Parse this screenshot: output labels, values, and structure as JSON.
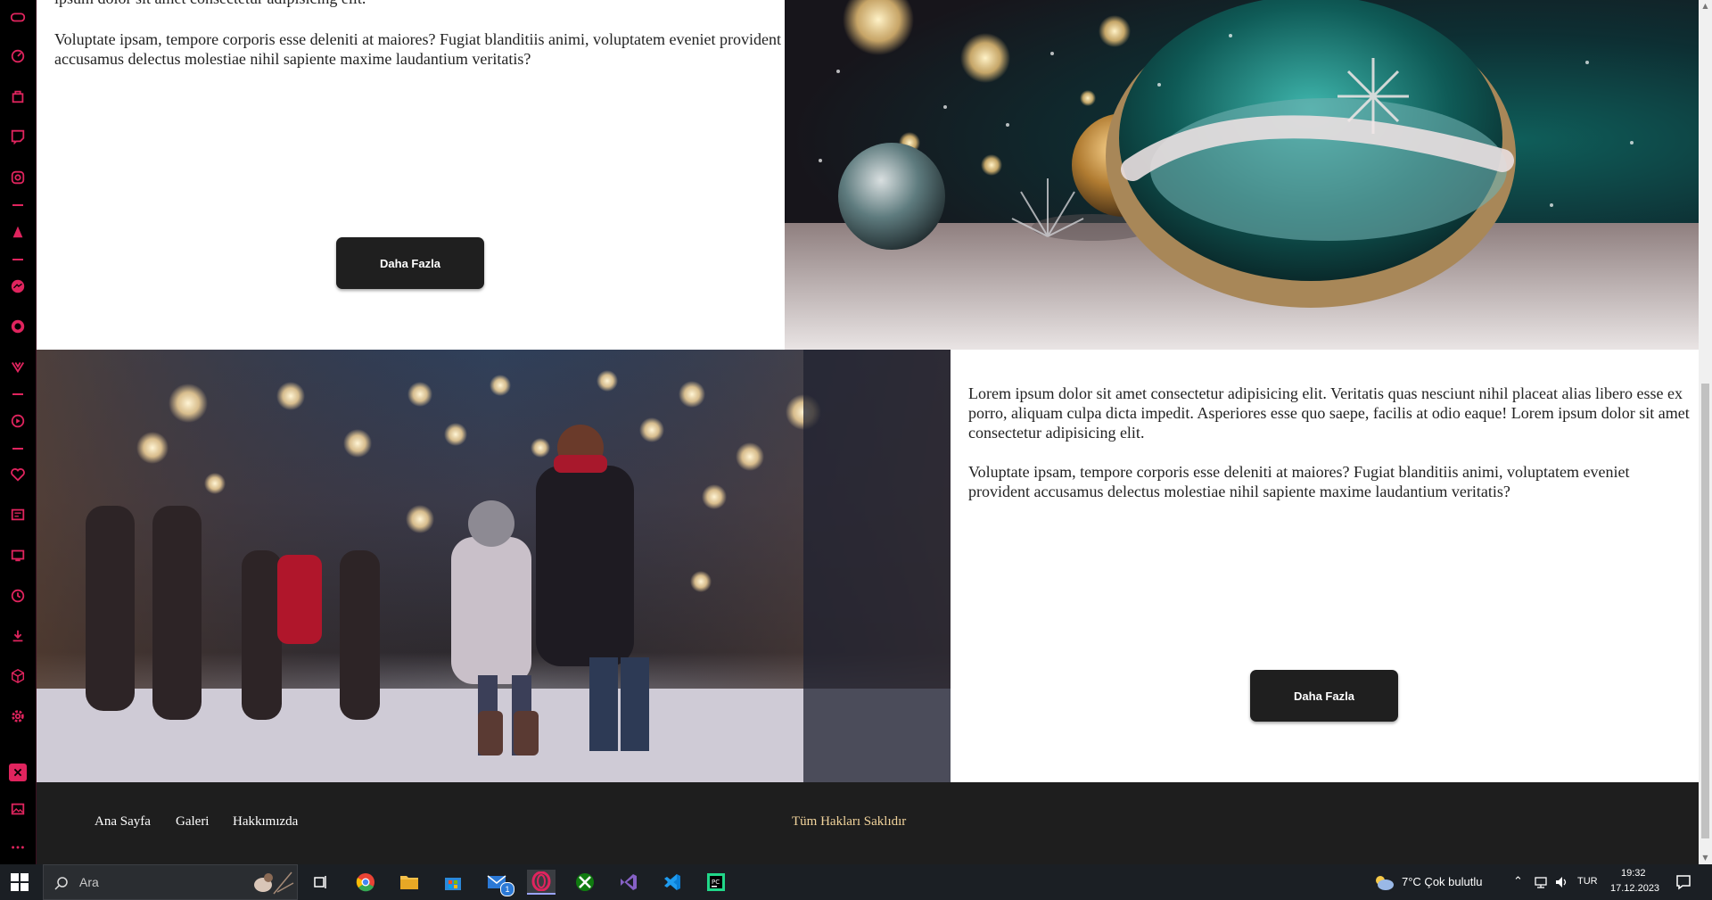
{
  "sidebar": {
    "icons": [
      "gamepad-icon",
      "speedometer-icon",
      "shopping-bag-icon",
      "twitch-icon",
      "instagram-icon",
      "aria-icon",
      "messenger-icon",
      "whatsapp-icon",
      "vk-icon",
      "player-icon",
      "heart-icon",
      "news-icon",
      "tabs-icon",
      "history-icon",
      "download-icon",
      "cube-icon",
      "settings-icon",
      "pinboard-icon",
      "gallery-icon",
      "more-icon"
    ]
  },
  "section1": {
    "paragraph1_tail": "ipsum dolor sit amet consectetur adipisicing elit.",
    "paragraph2": "Voluptate ipsam, tempore corporis esse deleniti at maiores? Fugiat blanditiis animi, voluptatem eveniet provident accusamus delectus molestiae nihil sapiente maxime laudantium veritatis?",
    "button_label": "Daha Fazla"
  },
  "section2": {
    "paragraph1": "Lorem ipsum dolor sit amet consectetur adipisicing elit. Veritatis quas nesciunt nihil placeat alias libero esse ex porro, aliquam culpa dicta impedit. Asperiores esse quo saepe, facilis at odio eaque! Lorem ipsum dolor sit amet consectetur adipisicing elit.",
    "paragraph2": "Voluptate ipsam, tempore corporis esse deleniti at maiores? Fugiat blanditiis animi, voluptatem eveniet provident accusamus delectus molestiae nihil sapiente maxime laudantium veritatis?",
    "button_label": "Daha Fazla"
  },
  "footer": {
    "links": [
      "Ana Sayfa",
      "Galeri",
      "Hakkımızda"
    ],
    "copyright": "Tüm Hakları Saklıdır"
  },
  "taskbar": {
    "search_placeholder": "Ara",
    "apps": [
      "task-view-icon",
      "chrome-icon",
      "file-explorer-icon",
      "store-icon",
      "mail-icon",
      "opera-icon",
      "xbox-icon",
      "visual-studio-icon",
      "vscode-icon",
      "pycharm-icon"
    ],
    "mail_badge": "1",
    "weather": "7°C  Çok bulutlu",
    "language": "TUR",
    "time": "19:32",
    "date": "17.12.2023"
  },
  "colors": {
    "accent": "#e0245e",
    "button_bg": "#1f1f1f",
    "footer_bg": "#1e1e1e",
    "copyright": "#f2d49c"
  }
}
